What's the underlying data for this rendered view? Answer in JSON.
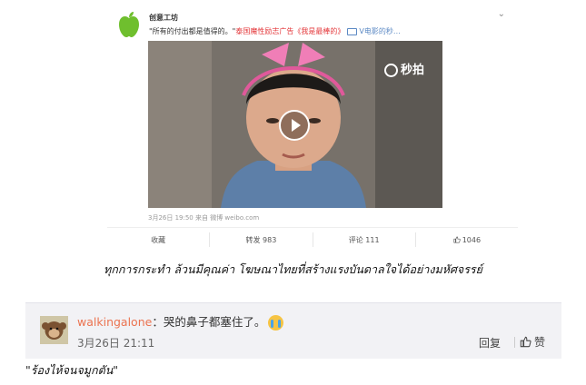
{
  "post": {
    "author": "创意工坊",
    "text_quote": "\"所有的付出都是值得的。\"",
    "text_red_1": "泰国魔性励志",
    "text_red_2": "广告《我是最棒的》",
    "text_link": "V电影的秒…",
    "watermark": "秒拍",
    "meta": "3月26日 19:50 来自 微博 weibo.com",
    "actions": {
      "favorite": "收藏",
      "repost": "转发 983",
      "comment": "评论 111",
      "like": "1046"
    }
  },
  "caption_top": "ทุกการกระทำ ล้วนมีคุณค่า โฆษณาไทยที่สร้างแรงบันดาลใจได้อย่างมหัศจรรย์",
  "comment": {
    "username": "walkingalone",
    "text": "：哭的鼻子都塞住了。",
    "time": "3月26日 21:11",
    "reply": "回复",
    "like": "赞"
  },
  "caption_bottom": "\"ร้องไห้จนจมูกตัน\"",
  "colors": {
    "username": "#eb7350",
    "link_red": "#e4393c",
    "link_blue": "#5b89c4",
    "comment_bg": "#f2f2f5"
  }
}
